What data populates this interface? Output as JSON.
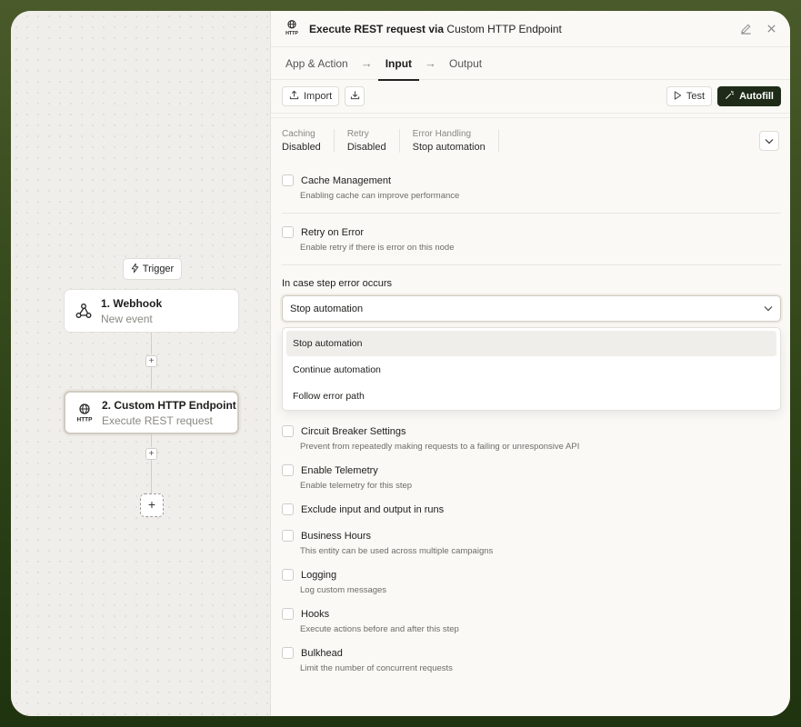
{
  "canvas": {
    "trigger_label": "Trigger",
    "nodes": [
      {
        "title": "1. Webhook",
        "subtitle": "New event",
        "icon": "webhook-icon"
      },
      {
        "title": "2. Custom HTTP Endpoint",
        "subtitle": "Execute REST request",
        "icon": "http-globe-icon",
        "selected": true
      }
    ],
    "add_small": "+",
    "add_big": "+"
  },
  "panel": {
    "header": {
      "title_bold": "Execute REST request via",
      "title_rest": " Custom HTTP Endpoint",
      "icon": "http-globe-icon"
    },
    "tabs": [
      {
        "label": "App & Action",
        "active": false
      },
      {
        "label": "Input",
        "active": true
      },
      {
        "label": "Output",
        "active": false
      }
    ],
    "toolbar": {
      "import_label": "Import",
      "test_label": "Test",
      "autofill_label": "Autofill"
    },
    "summary": [
      {
        "label": "Caching",
        "value": "Disabled"
      },
      {
        "label": "Retry",
        "value": "Disabled"
      },
      {
        "label": "Error Handling",
        "value": "Stop automation"
      }
    ],
    "options_top": [
      {
        "label": "Cache Management",
        "desc": "Enabling cache can improve performance"
      },
      {
        "label": "Retry on Error",
        "desc": "Enable retry if there is error on this node"
      }
    ],
    "error_field": {
      "label": "In case step error occurs",
      "selected": "Stop automation",
      "options": [
        "Stop automation",
        "Continue automation",
        "Follow error path"
      ]
    },
    "options_bottom": [
      {
        "label": "Circuit Breaker Settings",
        "desc": "Prevent from repeatedly making requests to a failing or unresponsive API"
      },
      {
        "label": "Enable Telemetry",
        "desc": "Enable telemetry for this step"
      },
      {
        "label": "Exclude input and output in runs",
        "desc": ""
      },
      {
        "label": "Business Hours",
        "desc": "This entity can be used across multiple campaigns"
      },
      {
        "label": "Logging",
        "desc": "Log custom messages"
      },
      {
        "label": "Hooks",
        "desc": "Execute actions before and after this step"
      },
      {
        "label": "Bulkhead",
        "desc": "Limit the number of concurrent requests"
      }
    ]
  }
}
